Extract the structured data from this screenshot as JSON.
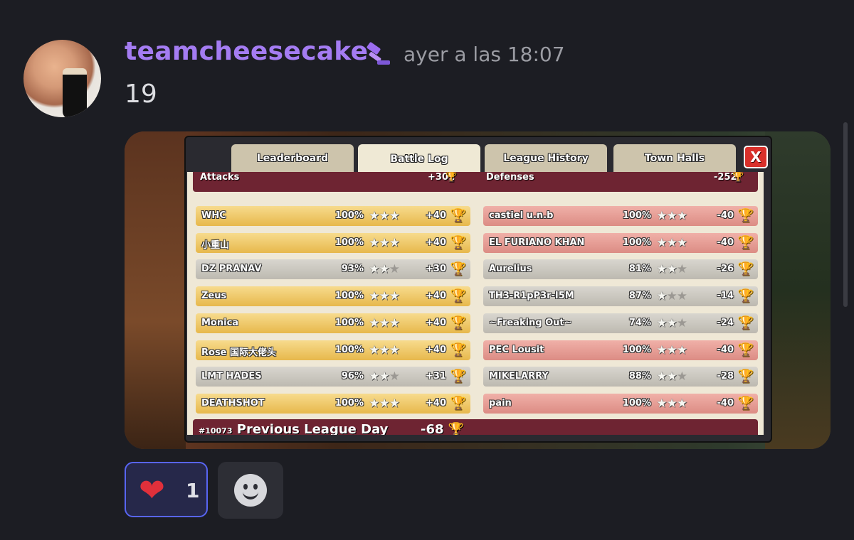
{
  "message": {
    "username": "teamcheesecake",
    "timestamp": "ayer a las 18:07",
    "text": "19",
    "badge_icon": "gavel-icon",
    "avatar_label": "GUINNESS"
  },
  "game": {
    "tabs": [
      "Leaderboard",
      "Battle Log",
      "League History",
      "Town Halls"
    ],
    "active_tab": "Battle Log",
    "close_label": "X",
    "attacks_label": "Attacks",
    "attacks_total": "+301",
    "defenses_label": "Defenses",
    "defenses_total": "-252",
    "attacks": [
      {
        "name": "WHC",
        "pct": "100%",
        "stars": 3,
        "trophies": "+40",
        "style": "gold"
      },
      {
        "name": "小重山",
        "pct": "100%",
        "stars": 3,
        "trophies": "+40",
        "style": "gold"
      },
      {
        "name": "DZ PRANAV",
        "pct": "93%",
        "stars": 2,
        "trophies": "+30",
        "style": "silver"
      },
      {
        "name": "Zeus",
        "pct": "100%",
        "stars": 3,
        "trophies": "+40",
        "style": "gold"
      },
      {
        "name": "Monica",
        "pct": "100%",
        "stars": 3,
        "trophies": "+40",
        "style": "gold"
      },
      {
        "name": "Rose 国际大佬头",
        "pct": "100%",
        "stars": 3,
        "trophies": "+40",
        "style": "gold"
      },
      {
        "name": "LMT HADES",
        "pct": "96%",
        "stars": 2,
        "trophies": "+31",
        "style": "silver"
      },
      {
        "name": "DEATHSHOT",
        "pct": "100%",
        "stars": 3,
        "trophies": "+40",
        "style": "gold"
      }
    ],
    "defenses": [
      {
        "name": "castiel u.n.b",
        "pct": "100%",
        "stars": 3,
        "trophies": "-40",
        "style": "pink"
      },
      {
        "name": "EL FURIANO KHAN",
        "pct": "100%",
        "stars": 3,
        "trophies": "-40",
        "style": "pink"
      },
      {
        "name": "Aurelius",
        "pct": "81%",
        "stars": 2,
        "trophies": "-26",
        "style": "silver"
      },
      {
        "name": "TH3-R1pP3r-I5M",
        "pct": "87%",
        "stars": 1,
        "trophies": "-14",
        "style": "silver"
      },
      {
        "name": "~Freaking Out~",
        "pct": "74%",
        "stars": 2,
        "trophies": "-24",
        "style": "silver"
      },
      {
        "name": "PEC Lousit",
        "pct": "100%",
        "stars": 3,
        "trophies": "-40",
        "style": "pink"
      },
      {
        "name": "MIKELARRY",
        "pct": "88%",
        "stars": 2,
        "trophies": "-28",
        "style": "silver"
      },
      {
        "name": "pain",
        "pct": "100%",
        "stars": 3,
        "trophies": "-40",
        "style": "pink"
      }
    ],
    "footer_rank": "#10073",
    "footer_label": "Previous League Day",
    "footer_value": "-68"
  },
  "reactions": [
    {
      "emoji": "heart-icon",
      "count": "1"
    }
  ],
  "add_reaction_icon": "smiley-icon"
}
